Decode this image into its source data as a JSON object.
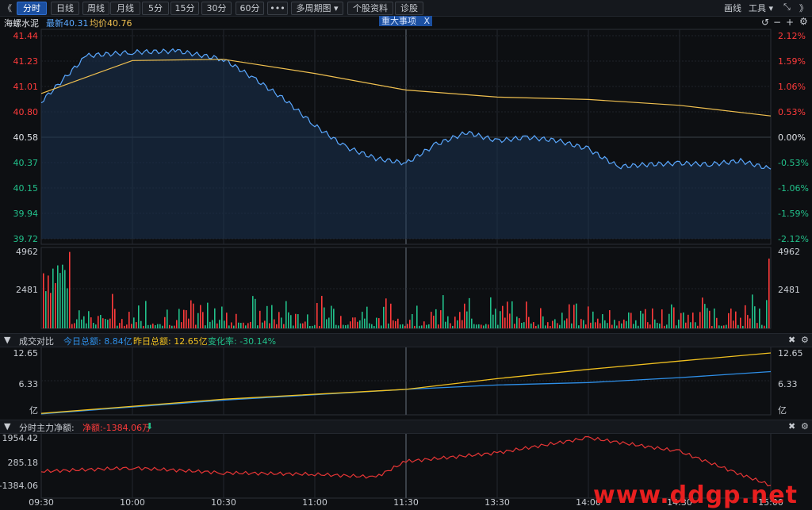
{
  "toolbar": {
    "back": "《",
    "tabs": [
      "分时",
      "日线",
      "周线",
      "月线",
      "5分",
      "15分",
      "30分",
      "60分",
      "•••",
      "多周期图 ▾",
      "个股资料",
      "诊股"
    ],
    "active_tab": 0,
    "draw": "画线",
    "tools": "工具 ▾",
    "expand": "⤡",
    "forward": "》"
  },
  "info": {
    "name": "海螺水泥",
    "latest": "最新40.31",
    "avg": "均价40.76",
    "event": "重大事项",
    "event_close": "X"
  },
  "price_axis": {
    "left": [
      "41.44",
      "41.23",
      "41.01",
      "40.80",
      "40.58",
      "40.37",
      "40.15",
      "39.94",
      "39.72"
    ],
    "right": [
      "2.12%",
      "1.59%",
      "1.06%",
      "0.53%",
      "0.00%",
      "-0.53%",
      "-1.06%",
      "-1.59%",
      "-2.12%"
    ]
  },
  "volume_axis": {
    "left": [
      "4962",
      "2481"
    ],
    "right": [
      "4962",
      "2481"
    ]
  },
  "compare": {
    "title": "成交对比",
    "today": "今日总额: 8.84亿",
    "yesterday": "昨日总额: 12.65亿",
    "change": "变化率: -30.14%",
    "axis_left": [
      "12.65",
      "6.33",
      "亿"
    ],
    "axis_right": [
      "12.65",
      "6.33",
      "亿"
    ]
  },
  "flow": {
    "title": "分时主力净额:",
    "net": "净额:-1384.06万",
    "arrow": "⬇",
    "axis_left": [
      "1954.42",
      "285.18",
      "-1384.06"
    ]
  },
  "time_axis": [
    "09:30",
    "10:00",
    "10:30",
    "11:00",
    "11:30",
    "13:30",
    "14:00",
    "14:30",
    "15:00"
  ],
  "watermark": "www.ddgp.net",
  "colors": {
    "up": "#ff3b3b",
    "down": "#22c08a",
    "price": "#5aa8ff",
    "avg": "#f0c050",
    "today": "#2e8fe8",
    "yesterday": "#f0c020",
    "flow": "#e63535"
  },
  "chart_data": [
    {
      "type": "line",
      "title": "海螺水泥 分时",
      "series": [
        {
          "name": "最新",
          "x": [
            "09:30",
            "09:45",
            "10:00",
            "10:15",
            "10:30",
            "10:40",
            "10:50",
            "11:00",
            "11:10",
            "11:20",
            "11:30",
            "13:10",
            "13:20",
            "13:30",
            "13:40",
            "13:50",
            "14:00",
            "14:10",
            "14:20",
            "14:30",
            "14:40",
            "14:50",
            "15:00"
          ],
          "values": [
            40.88,
            41.27,
            41.3,
            41.31,
            41.24,
            41.08,
            40.9,
            40.68,
            40.5,
            40.4,
            40.36,
            40.52,
            40.62,
            40.55,
            40.58,
            40.55,
            40.48,
            40.33,
            40.35,
            40.36,
            40.35,
            40.38,
            40.31
          ]
        },
        {
          "name": "均价",
          "x": [
            "09:30",
            "10:00",
            "10:30",
            "11:00",
            "11:30",
            "13:30",
            "14:00",
            "14:30",
            "15:00"
          ],
          "values": [
            40.95,
            41.23,
            41.24,
            41.12,
            40.98,
            40.92,
            40.9,
            40.85,
            40.76
          ]
        }
      ],
      "ylim": [
        39.72,
        41.44
      ],
      "ylabel_right": "涨跌幅%"
    },
    {
      "type": "bar",
      "title": "成交量",
      "ylim": [
        0,
        4962
      ]
    },
    {
      "type": "line",
      "title": "成交对比",
      "series": [
        {
          "name": "今日总额",
          "x": [
            "09:30",
            "10:30",
            "11:30",
            "13:30",
            "14:00",
            "14:30",
            "15:00"
          ],
          "values": [
            0.2,
            3.0,
            5.2,
            6.1,
            6.6,
            7.6,
            8.84
          ]
        },
        {
          "name": "昨日总额",
          "x": [
            "09:30",
            "10:30",
            "11:30",
            "13:30",
            "14:00",
            "14:30",
            "15:00"
          ],
          "values": [
            0.3,
            3.2,
            5.2,
            7.4,
            9.3,
            11.0,
            12.65
          ]
        }
      ],
      "ylim": [
        0,
        12.65
      ],
      "ylabel": "亿"
    },
    {
      "type": "line",
      "title": "分时主力净额",
      "series": [
        {
          "name": "净额",
          "x": [
            "09:30",
            "10:00",
            "10:30",
            "11:00",
            "11:20",
            "11:30",
            "13:30",
            "14:00",
            "14:30",
            "14:50",
            "15:00"
          ],
          "values": [
            -400,
            -150,
            -500,
            -600,
            -800,
            300,
            900,
            1954.42,
            1000,
            -600,
            -1384.06
          ]
        }
      ],
      "ylim": [
        -1384.06,
        1954.42
      ]
    }
  ]
}
